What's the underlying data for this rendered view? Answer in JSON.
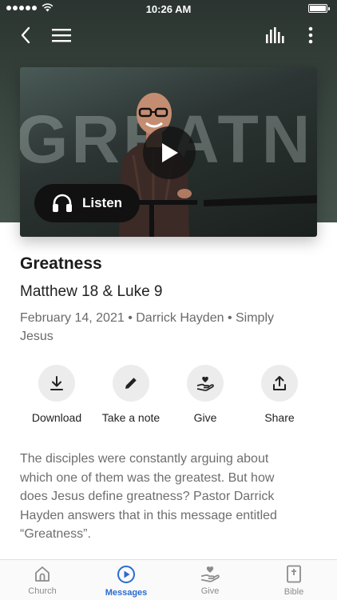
{
  "status_bar": {
    "time": "10:26 AM"
  },
  "video": {
    "background_text": "GREATNE",
    "listen_label": "Listen"
  },
  "sermon": {
    "title": "Greatness",
    "scripture": "Matthew 18 & Luke 9",
    "meta": "February 14, 2021 • Darrick Hayden • Simply Jesus",
    "description": "The disciples were constantly arguing about which one of them was the greatest. But how does Jesus define greatness? Pastor Darrick Hayden answers that in this message entitled “Greatness”."
  },
  "actions": [
    {
      "label": "Download",
      "icon": "download-icon"
    },
    {
      "label": "Take a note",
      "icon": "pencil-icon"
    },
    {
      "label": "Give",
      "icon": "give-hand-heart-icon"
    },
    {
      "label": "Share",
      "icon": "share-icon"
    }
  ],
  "tabs": [
    {
      "label": "Church",
      "icon": "church-icon",
      "active": false
    },
    {
      "label": "Messages",
      "icon": "play-circle-icon",
      "active": true
    },
    {
      "label": "Give",
      "icon": "give-hand-heart-icon",
      "active": false
    },
    {
      "label": "Bible",
      "icon": "bible-icon",
      "active": false
    }
  ],
  "colors": {
    "accent": "#2a6bd1",
    "header": "#3a4741",
    "tab_inactive": "#8c8c8c"
  }
}
